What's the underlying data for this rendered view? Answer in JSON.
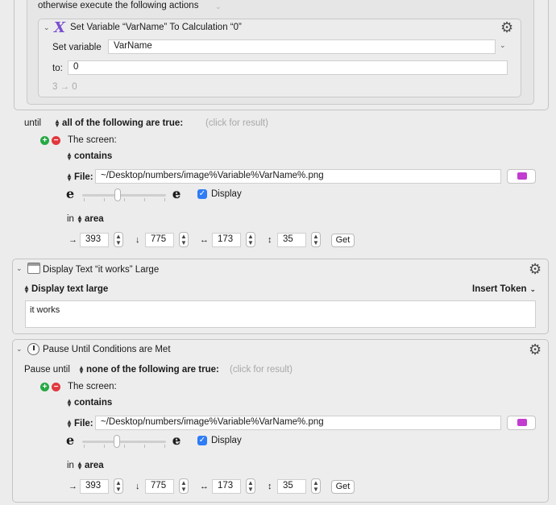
{
  "top_block": {
    "otherwise_label": "otherwise execute the following actions",
    "set_var_action": {
      "title": "Set Variable “VarName” To Calculation “0”",
      "set_variable_label": "Set variable",
      "variable_value": "VarName",
      "to_label": "to:",
      "to_value": "0",
      "result": "3 → 0"
    }
  },
  "until_condition": {
    "until_label": "until",
    "match_mode": "all of the following are true:",
    "click_for_result": "(click for result)",
    "condition_type": "The screen:",
    "operator": "contains",
    "file_label": "File:",
    "file_path": "~/Desktop/numbers/image%Variable%VarName%.png",
    "display_label": "Display",
    "display_checked": true,
    "in_label": "in",
    "area_label": "area",
    "left": "393",
    "top": "775",
    "width": "173",
    "height": "35",
    "get_label": "Get"
  },
  "display_text_action": {
    "title": "Display Text “it works” Large",
    "mode": "Display text large",
    "insert_token": "Insert Token",
    "text": "it works"
  },
  "pause_action": {
    "title": "Pause Until Conditions are Met",
    "pause_until_label": "Pause until",
    "match_mode": "none of the following are true:",
    "click_for_result": "(click for result)",
    "condition_type": "The screen:",
    "operator": "contains",
    "file_label": "File:",
    "file_path": "~/Desktop/numbers/image%Variable%VarName%.png",
    "display_label": "Display",
    "display_checked": true,
    "in_label": "in",
    "area_label": "area",
    "left": "393",
    "top": "775",
    "width": "173",
    "height": "35",
    "get_label": "Get"
  },
  "colors": {
    "accent_blue": "#2e7cf6",
    "variable_icon_purple": "#7a4fd1",
    "folder_magenta": "#c23cd0",
    "add_green": "#27a844",
    "remove_red": "#e0383e"
  }
}
